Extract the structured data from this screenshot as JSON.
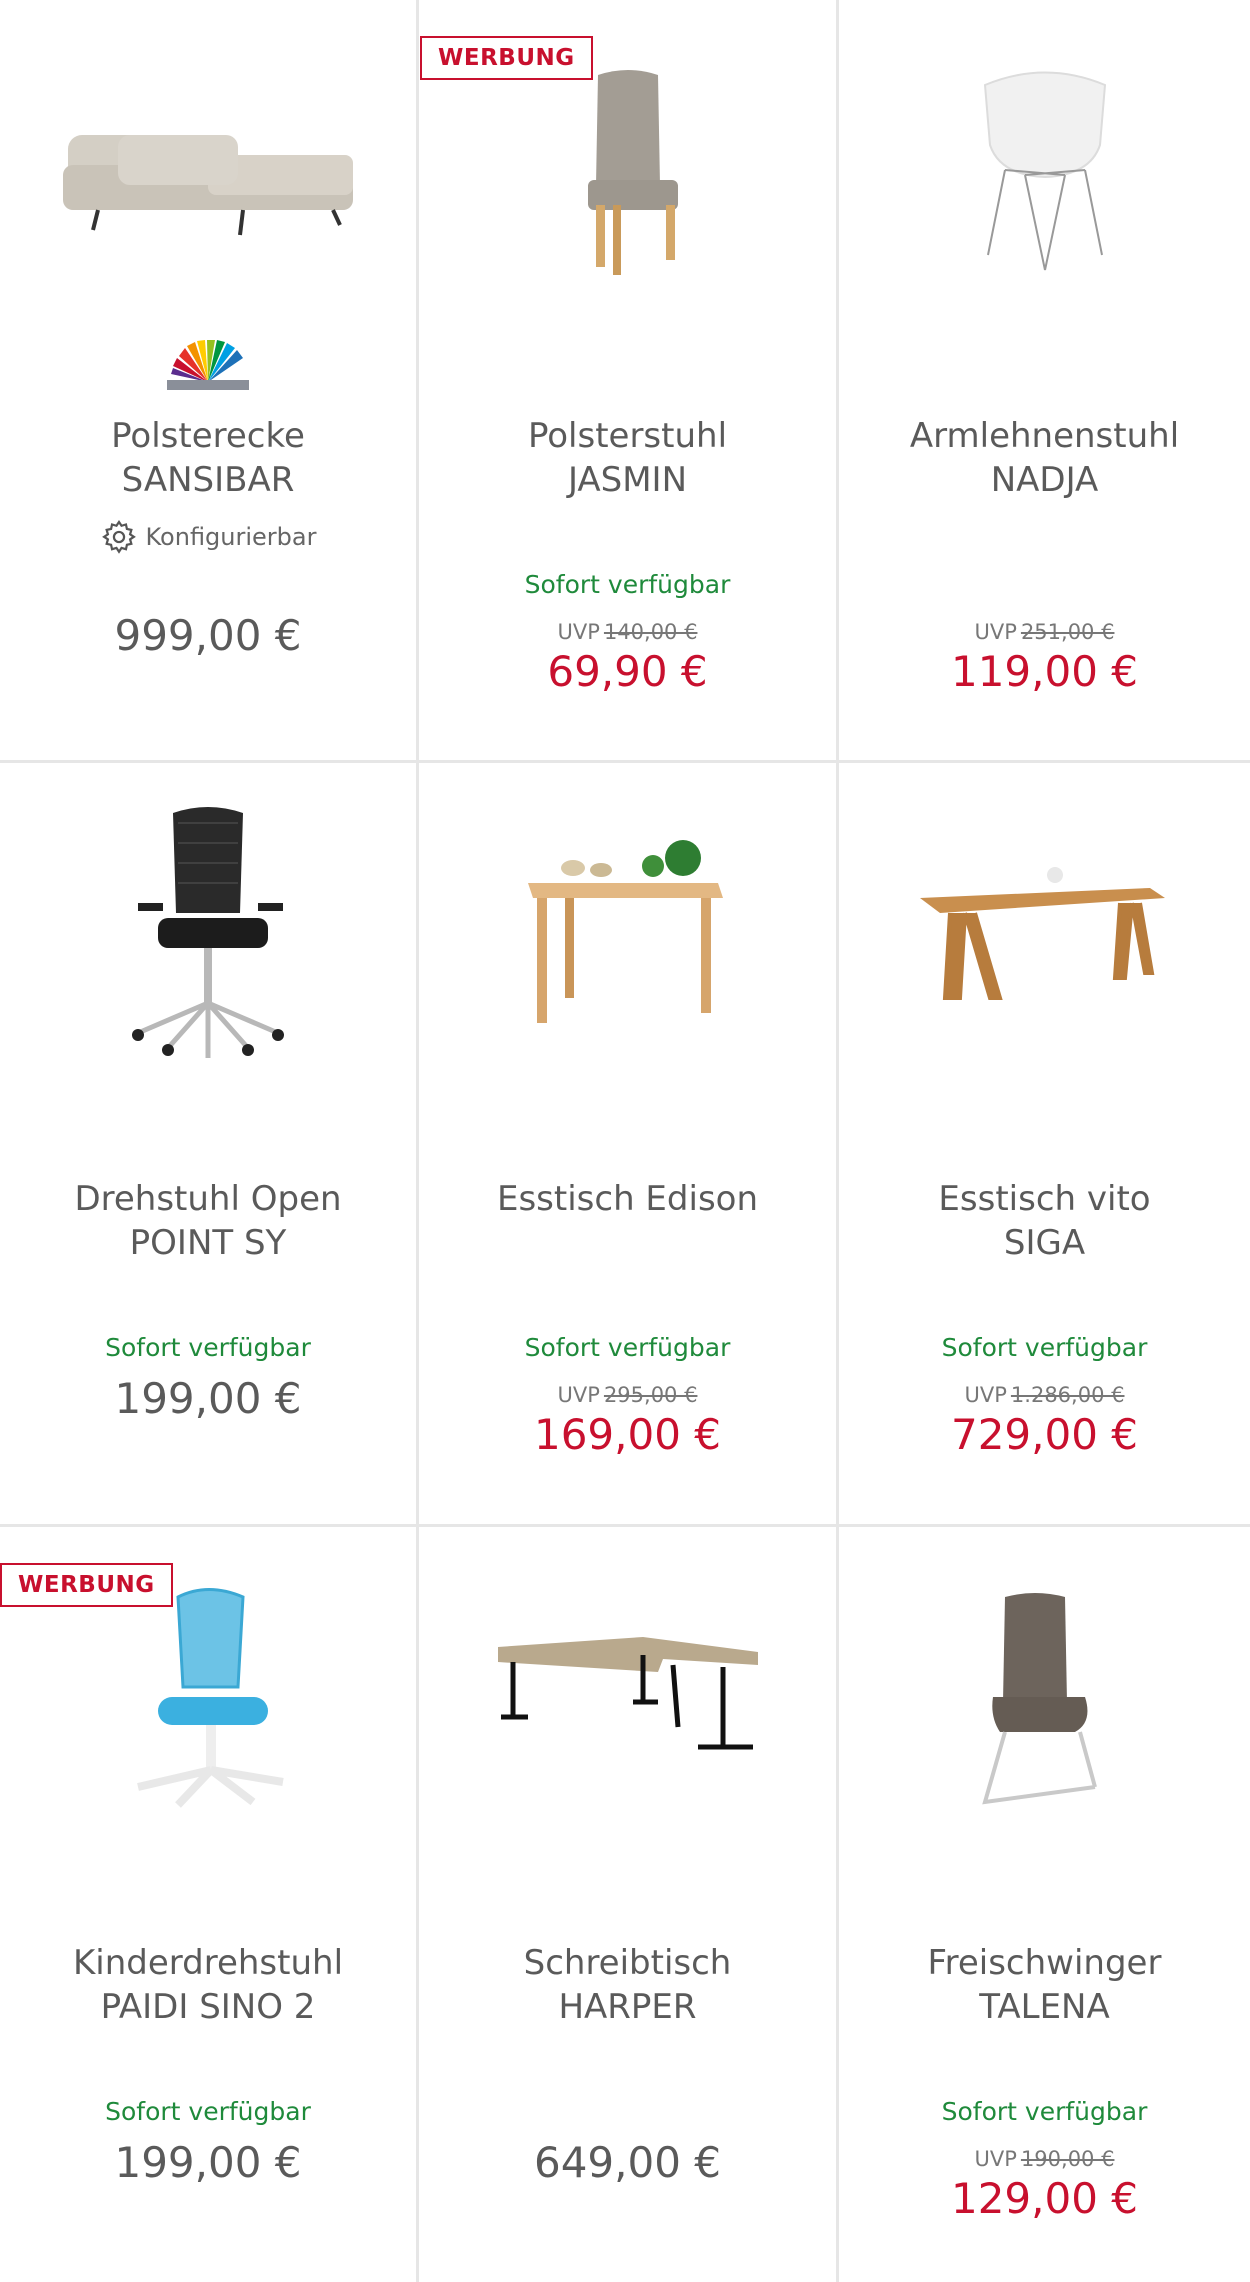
{
  "colors": {
    "sale": "#c8102e",
    "available": "#1f8a3b",
    "text": "#5a5a5a",
    "divider": "#e6e6e6"
  },
  "ad_label": "WERBUNG",
  "uvp_label": "UVP",
  "products": [
    {
      "title_line1": "Polsterecke",
      "title_line2": "SANSIBAR",
      "configurable": "Konfigurierbar",
      "price": "999,00 €",
      "icon": "sofa-image"
    },
    {
      "title_line1": "Polsterstuhl",
      "title_line2": "JASMIN",
      "availability": "Sofort verfügbar",
      "uvp": "140,00 €",
      "sale_price": "69,90 €",
      "icon": "chair-image"
    },
    {
      "title_line1": "Armlehnenstuhl",
      "title_line2": "NADJA",
      "uvp": "251,00 €",
      "sale_price": "119,00 €",
      "icon": "armchair-image"
    },
    {
      "title_line1": "Drehstuhl Open",
      "title_line2": "POINT SY",
      "availability": "Sofort verfügbar",
      "price": "199,00 €",
      "icon": "office-chair-image"
    },
    {
      "title_line1": "Esstisch Edison",
      "title_line2": "",
      "availability": "Sofort verfügbar",
      "uvp": "295,00 €",
      "sale_price": "169,00 €",
      "icon": "table-image"
    },
    {
      "title_line1": "Esstisch vito",
      "title_line2": "SIGA",
      "availability": "Sofort verfügbar",
      "uvp": "1.286,00 €",
      "sale_price": "729,00 €",
      "icon": "long-table-image"
    },
    {
      "title_line1": "Kinderdrehstuhl",
      "title_line2": "PAIDI SINO 2",
      "availability": "Sofort verfügbar",
      "price": "199,00 €",
      "icon": "kids-chair-image"
    },
    {
      "title_line1": "Schreibtisch",
      "title_line2": "HARPER",
      "price": "649,00 €",
      "icon": "desk-image"
    },
    {
      "title_line1": "Freischwinger",
      "title_line2": "TALENA",
      "availability": "Sofort verfügbar",
      "uvp": "190,00 €",
      "sale_price": "129,00 €",
      "icon": "cantilever-chair-image"
    }
  ]
}
